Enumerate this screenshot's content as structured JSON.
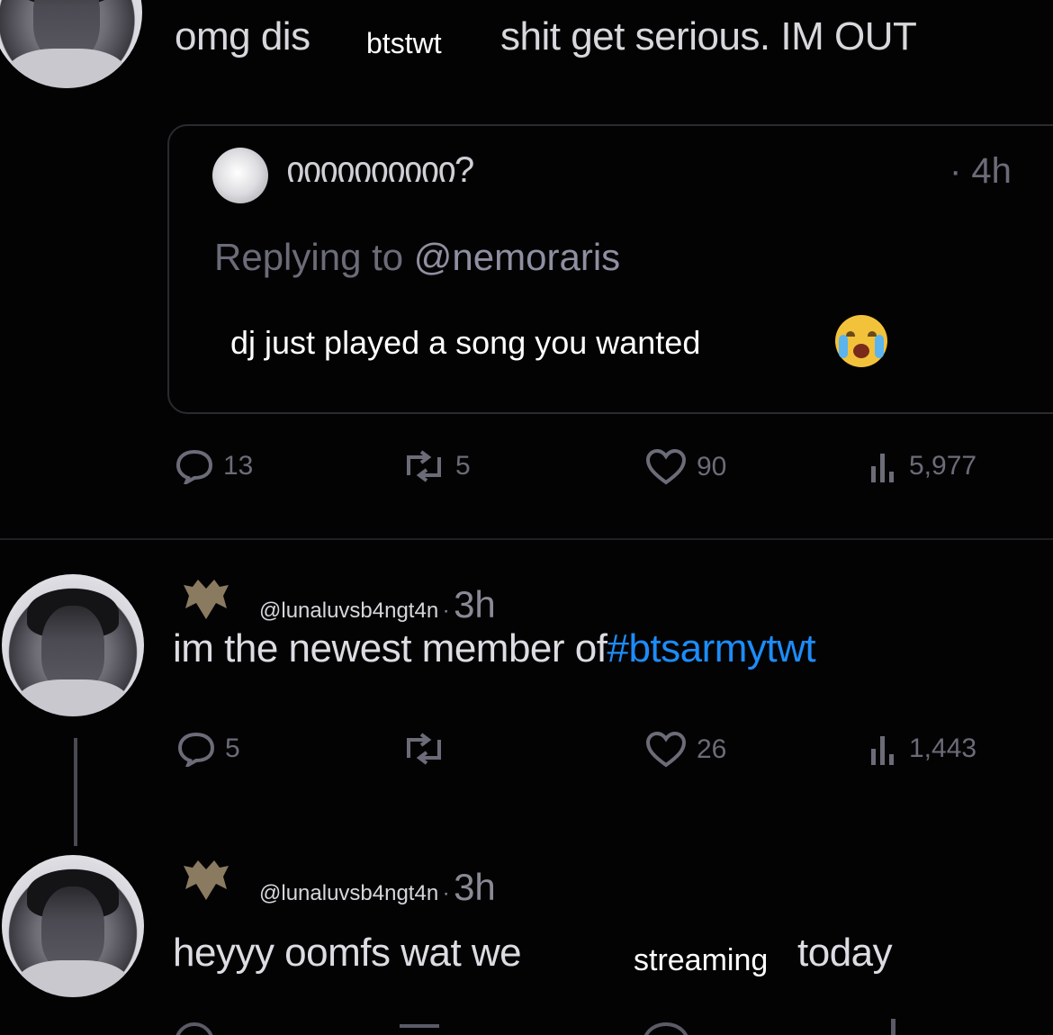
{
  "top_tweet": {
    "text_pre": "omg dis",
    "overlay_word": "btstwt",
    "text_post": "shit get serious. IM OUT"
  },
  "quoted_tweet": {
    "display_name": "იიიიიიიიიი?",
    "time": "· 4h",
    "replying_prefix": "Replying to",
    "replying_handle": "@nemoraris",
    "text": "dj just played a song you wanted",
    "emoji": "crying-face"
  },
  "top_actions": {
    "replies": "13",
    "retweets": "5",
    "likes": "90",
    "views": "5,977"
  },
  "tweet_two": {
    "handle": "@lunaluvsb4ngt4n",
    "dot": "·",
    "time": "3h",
    "text": "im the newest member of",
    "hashtag": "#btsarmytwt",
    "actions": {
      "replies": "5",
      "retweets": "",
      "likes": "26",
      "views": "1,443"
    }
  },
  "tweet_three": {
    "handle": "@lunaluvsb4ngt4n",
    "dot": "·",
    "time": "3h",
    "text_pre": "heyyy oomfs wat we",
    "overlay_word": "streaming",
    "text_post": "today"
  },
  "colors": {
    "background": "#030304",
    "hashtag": "#1d8cf8",
    "muted": "#6b6c78"
  }
}
